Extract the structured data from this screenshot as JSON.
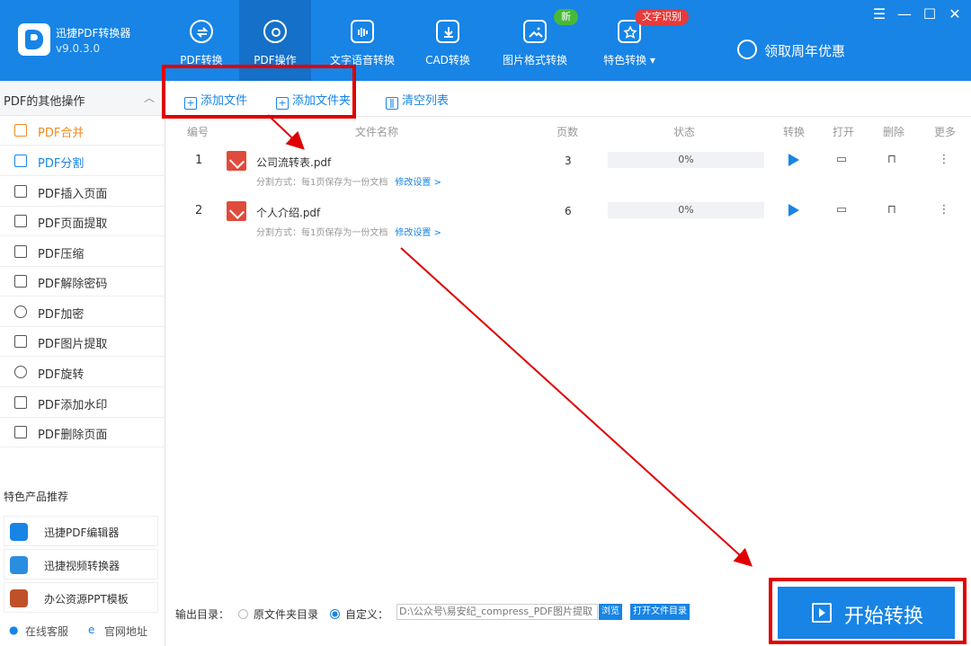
{
  "app": {
    "name": "迅捷PDF转换器",
    "version": "v9.0.3.0"
  },
  "nav": [
    {
      "label": "PDF转换"
    },
    {
      "label": "PDF操作"
    },
    {
      "label": "文字语音转换"
    },
    {
      "label": "CAD转换"
    },
    {
      "label": "图片格式转换"
    },
    {
      "label": "特色转换 ▾"
    }
  ],
  "badges": {
    "new": "新",
    "ocr": "文字识别"
  },
  "promo": "领取周年优惠",
  "sidebar": {
    "header": "PDF的其他操作",
    "items": [
      {
        "label": "PDF合并"
      },
      {
        "label": "PDF分割"
      },
      {
        "label": "PDF插入页面"
      },
      {
        "label": "PDF页面提取"
      },
      {
        "label": "PDF压缩"
      },
      {
        "label": "PDF解除密码"
      },
      {
        "label": "PDF加密"
      },
      {
        "label": "PDF图片提取"
      },
      {
        "label": "PDF旋转"
      },
      {
        "label": "PDF添加水印"
      },
      {
        "label": "PDF删除页面"
      }
    ],
    "featured_title": "特色产品推荐",
    "featured": [
      {
        "label": "迅捷PDF编辑器"
      },
      {
        "label": "迅捷视频转换器"
      },
      {
        "label": "办公资源PPT模板"
      }
    ],
    "footer": {
      "service": "在线客服",
      "website": "官网地址"
    }
  },
  "toolbar": {
    "add_file": "添加文件",
    "add_folder": "添加文件夹",
    "clear": "清空列表"
  },
  "table": {
    "headers": [
      "编号",
      "文件名称",
      "页数",
      "状态",
      "转换",
      "打开",
      "删除",
      "更多"
    ],
    "rows": [
      {
        "no": "1",
        "name": "公司流转表.pdf",
        "pages": "3",
        "status": "0%",
        "split": "分割方式：每1页保存为一份文档",
        "modify": "修改设置 >"
      },
      {
        "no": "2",
        "name": "个人介绍.pdf",
        "pages": "6",
        "status": "0%",
        "split": "分割方式：每1页保存为一份文档",
        "modify": "修改设置 >"
      }
    ]
  },
  "output": {
    "label": "输出目录：",
    "original": "原文件夹目录",
    "custom": "自定义：",
    "path": "D:\\公众号\\易安纪_compress_PDF图片提取",
    "browse": "浏览",
    "open_dir": "打开文件目录"
  },
  "start_button": "开始转换",
  "colors": {
    "primary": "#1784e6",
    "accent_orange": "#f08a20",
    "annotation_red": "#e00000"
  }
}
